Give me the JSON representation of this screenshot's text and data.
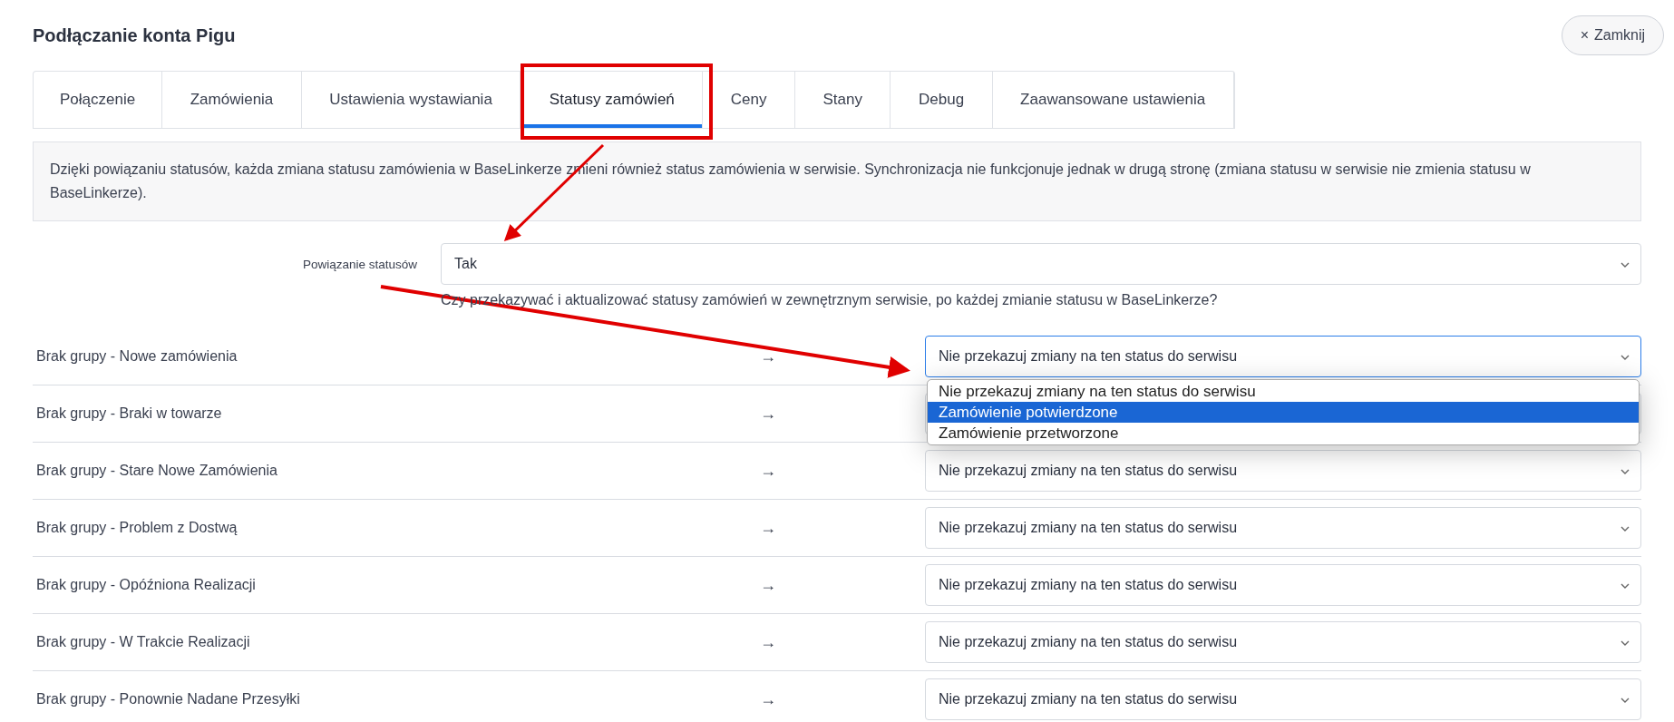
{
  "dialog": {
    "title": "Podłączanie konta Pigu",
    "close_button": {
      "icon": "×",
      "label": "Zamknij"
    }
  },
  "tabs": [
    {
      "label": "Połączenie",
      "selected": false
    },
    {
      "label": "Zamówienia",
      "selected": false
    },
    {
      "label": "Ustawienia wystawiania",
      "selected": false
    },
    {
      "label": "Statusy zamówień",
      "selected": true
    },
    {
      "label": "Ceny",
      "selected": false
    },
    {
      "label": "Stany",
      "selected": false
    },
    {
      "label": "Debug",
      "selected": false
    },
    {
      "label": "Zaawansowane ustawienia",
      "selected": false
    }
  ],
  "info_text": "Dzięki powiązaniu statusów, każda zmiana statusu zamówienia w BaseLinkerze zmieni również status zamówienia w serwisie. Synchronizacja nie funkcjonuje jednak w drugą stronę (zmiana statusu w serwisie nie zmienia statusu w BaseLinkerze).",
  "status_link": {
    "label": "Powiązanie statusów",
    "value": "Tak",
    "help": "Czy przekazywać i aktualizować statusy zamówień w zewnętrznym serwisie, po każdej zmianie statusu w BaseLinkerze?"
  },
  "mappings": [
    {
      "source": "Brak grupy - Nowe zamówienia",
      "arrow": "→",
      "target": "Nie przekazuj zmiany na ten status do serwisu",
      "focused": true,
      "options": [
        {
          "label": "Nie przekazuj zmiany na ten status do serwisu",
          "selected": false
        },
        {
          "label": "Zamówienie potwierdzone",
          "selected": true
        },
        {
          "label": "Zamówienie przetworzone",
          "selected": false
        }
      ]
    },
    {
      "source": "Brak grupy - Braki w towarze",
      "arrow": "→",
      "focused": false
    },
    {
      "source": "Brak grupy - Stare Nowe Zamówienia",
      "arrow": "→",
      "target": "Nie przekazuj zmiany na ten status do serwisu",
      "focused": false
    },
    {
      "source": "Brak grupy - Problem z Dostwą",
      "arrow": "→",
      "target": "Nie przekazuj zmiany na ten status do serwisu",
      "focused": false
    },
    {
      "source": "Brak grupy - Opóźniona Realizacji",
      "arrow": "→",
      "target": "Nie przekazuj zmiany na ten status do serwisu",
      "focused": false
    },
    {
      "source": "Brak grupy - W Trakcie Realizacji",
      "arrow": "→",
      "target": "Nie przekazuj zmiany na ten status do serwisu",
      "focused": false
    },
    {
      "source": "Brak grupy - Ponownie Nadane Przesyłki",
      "arrow": "→",
      "target": "Nie przekazuj zmiany na ten status do serwisu",
      "focused": false
    }
  ]
}
